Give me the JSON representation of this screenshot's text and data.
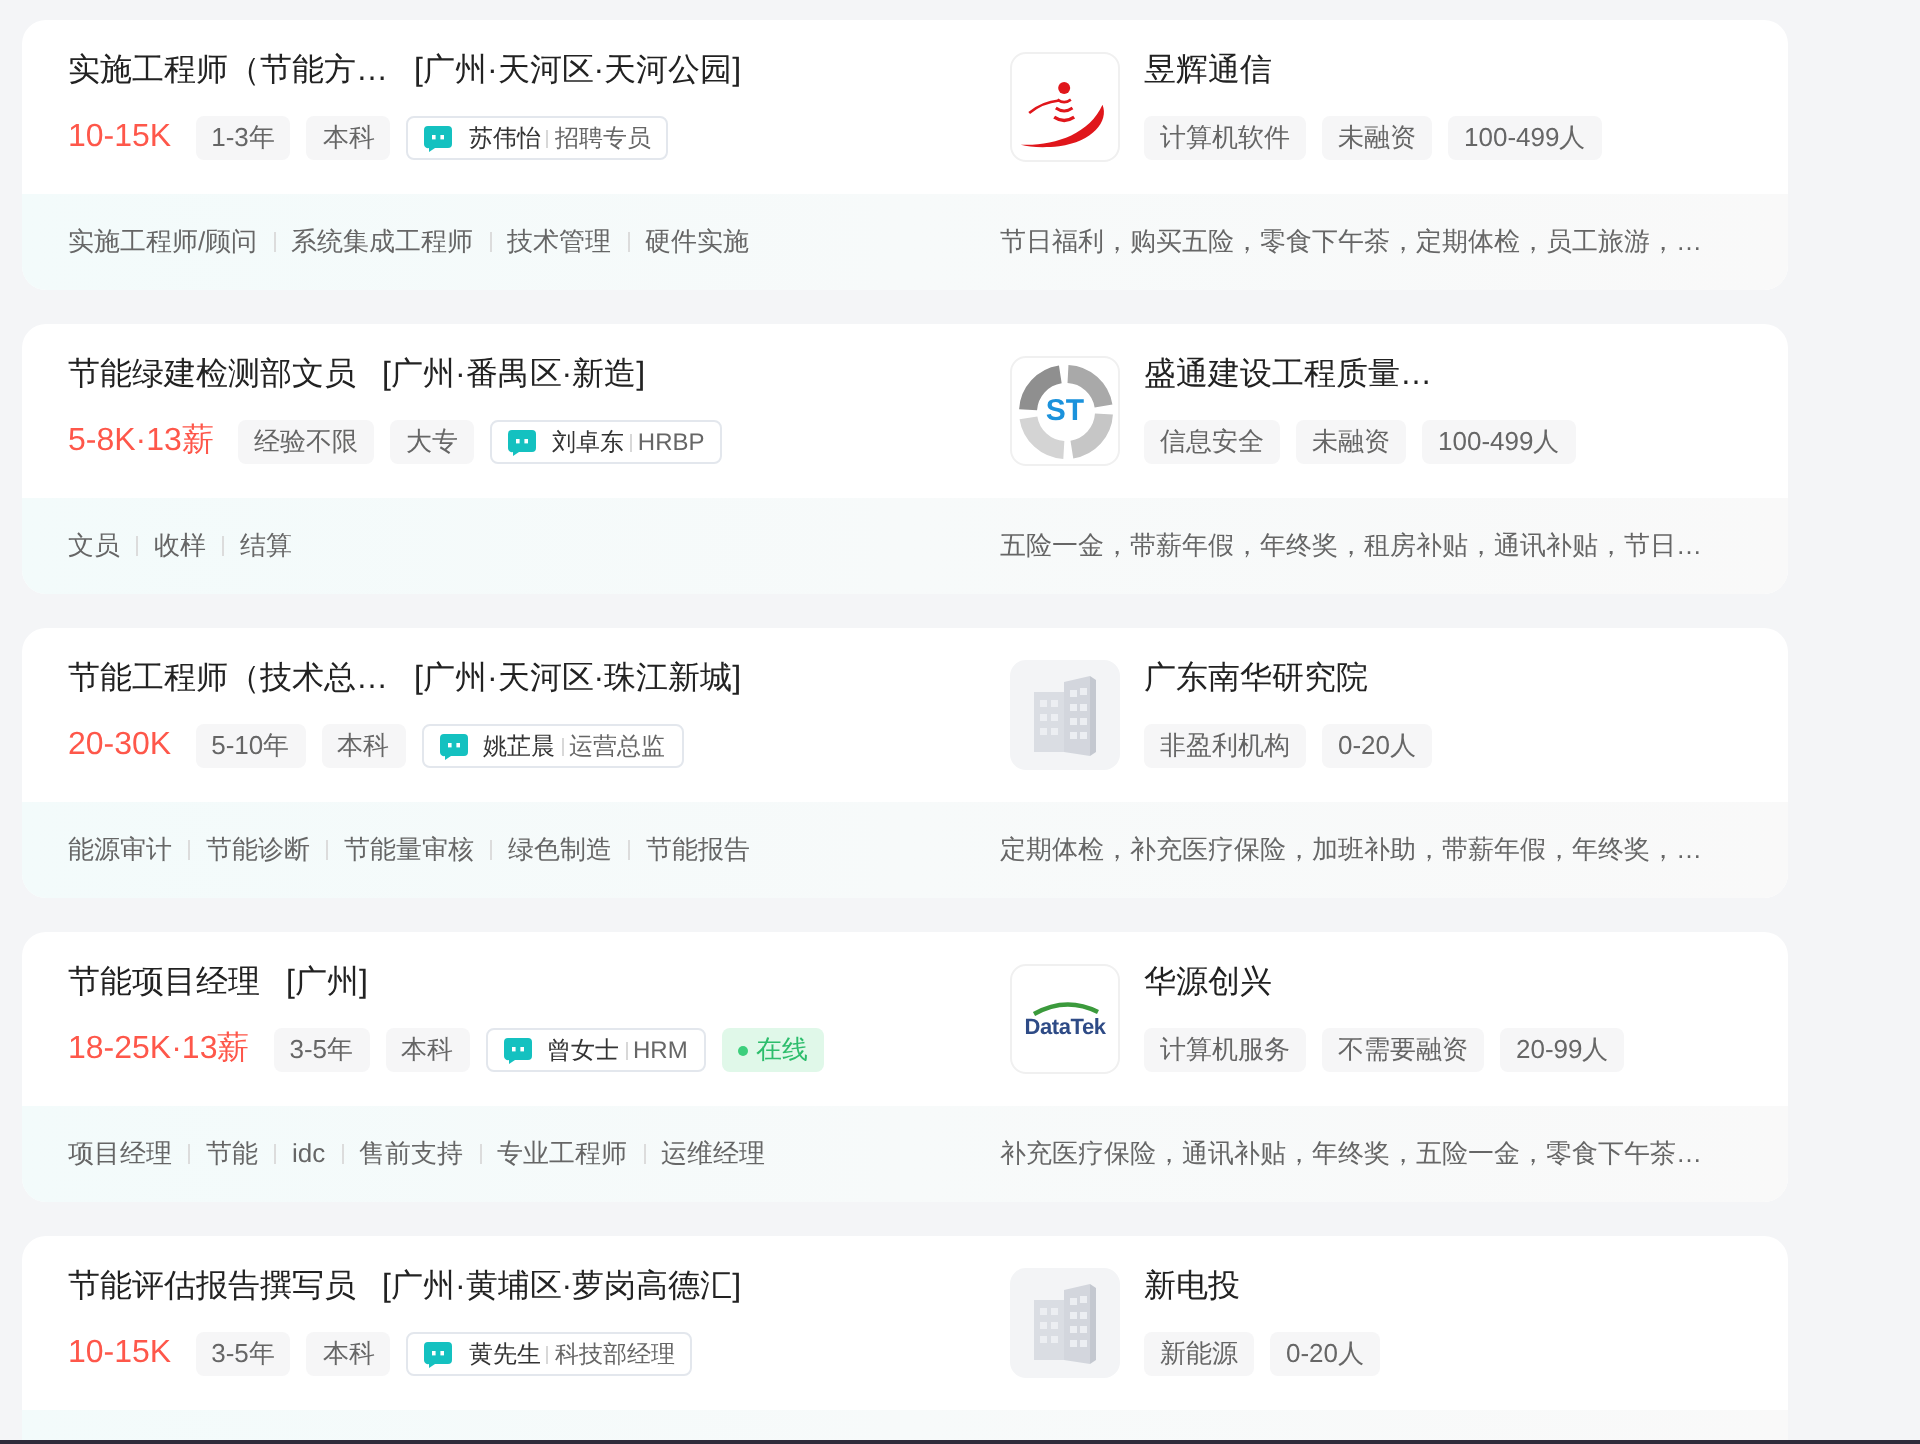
{
  "jobs": [
    {
      "title": "实施工程师（节能方…",
      "location": "[广州·天河区·天河公园]",
      "salary": "10-15K",
      "tags": [
        "1-3年",
        "本科"
      ],
      "recruiter": {
        "name": "苏伟怡",
        "role": "招聘专员"
      },
      "company": {
        "name": "昱辉通信",
        "logo": {
          "kind": "signal"
        },
        "tags": [
          "计算机软件",
          "未融资",
          "100-499人"
        ]
      },
      "skills": [
        "实施工程师/顾问",
        "系统集成工程师",
        "技术管理",
        "硬件实施"
      ],
      "welfare": "节日福利，购买五险，零食下午茶，定期体检，员工旅游，…"
    },
    {
      "title": "节能绿建检测部文员",
      "location": "[广州·番禺区·新造]",
      "salary": "5-8K·13薪",
      "tags": [
        "经验不限",
        "大专"
      ],
      "recruiter": {
        "name": "刘卓东",
        "role": "HRBP"
      },
      "company": {
        "name": "盛通建设工程质量…",
        "logo": {
          "kind": "ring",
          "text": "ST"
        },
        "tags": [
          "信息安全",
          "未融资",
          "100-499人"
        ]
      },
      "skills": [
        "文员",
        "收样",
        "结算"
      ],
      "welfare": "五险一金，带薪年假，年终奖，租房补贴，通讯补贴，节日…"
    },
    {
      "title": "节能工程师（技术总…",
      "location": "[广州·天河区·珠江新城]",
      "salary": "20-30K",
      "tags": [
        "5-10年",
        "本科"
      ],
      "recruiter": {
        "name": "姚芷晨",
        "role": "运营总监"
      },
      "company": {
        "name": "广东南华研究院",
        "logo": {
          "kind": "building"
        },
        "tags": [
          "非盈利机构",
          "0-20人"
        ]
      },
      "skills": [
        "能源审计",
        "节能诊断",
        "节能量审核",
        "绿色制造",
        "节能报告"
      ],
      "welfare": "定期体检，补充医疗保险，加班补助，带薪年假，年终奖，…"
    },
    {
      "title": "节能项目经理",
      "location": "[广州]",
      "salary": "18-25K·13薪",
      "tags": [
        "3-5年",
        "本科"
      ],
      "recruiter": {
        "name": "曾女士",
        "role": "HRM",
        "status": "在线"
      },
      "company": {
        "name": "华源创兴",
        "logo": {
          "kind": "arc",
          "text": "DataTek"
        },
        "tags": [
          "计算机服务",
          "不需要融资",
          "20-99人"
        ]
      },
      "skills": [
        "项目经理",
        "节能",
        "idc",
        "售前支持",
        "专业工程师",
        "运维经理"
      ],
      "welfare": "补充医疗保险，通讯补贴，年终奖，五险一金，零食下午茶…"
    },
    {
      "title": "节能评估报告撰写员",
      "location": "[广州·黄埔区·萝岗高德汇]",
      "salary": "10-15K",
      "tags": [
        "3-5年",
        "本科"
      ],
      "recruiter": {
        "name": "黄先生",
        "role": "科技部经理"
      },
      "company": {
        "name": "新电投",
        "logo": {
          "kind": "building"
        },
        "tags": [
          "新能源",
          "0-20人"
        ]
      }
    }
  ]
}
